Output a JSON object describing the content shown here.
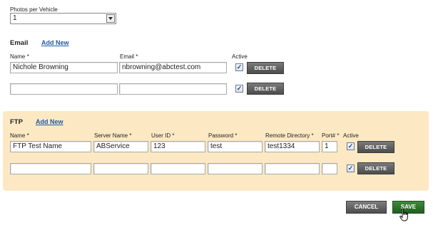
{
  "photos": {
    "label": "Photos per Vehicle",
    "selected": "1"
  },
  "email": {
    "title": "Email",
    "add_new": "Add New",
    "headers": {
      "name": "Name *",
      "email": "Email *",
      "active": "Active"
    },
    "rows": [
      {
        "name": "Nichole Browning",
        "email": "nbrowning@abctest.com",
        "active": true,
        "delete": "DELETE"
      },
      {
        "name": "",
        "email": "",
        "active": true,
        "delete": "DELETE"
      }
    ]
  },
  "ftp": {
    "title": "FTP",
    "add_new": "Add New",
    "headers": {
      "name": "Name *",
      "server": "Server Name *",
      "user": "User ID *",
      "password": "Password *",
      "remote": "Remote Directory *",
      "port": "Port# *",
      "active": "Active"
    },
    "rows": [
      {
        "name": "FTP Test Name",
        "server": "ABService",
        "user": "123",
        "password": "test",
        "remote": "test1334",
        "port": "1",
        "active": true,
        "delete": "DELETE"
      },
      {
        "name": "",
        "server": "",
        "user": "",
        "password": "",
        "remote": "",
        "port": "",
        "active": true,
        "delete": "DELETE"
      }
    ]
  },
  "actions": {
    "cancel": "CANCEL",
    "save": "SAVE"
  },
  "icons": {
    "checkbox": "checkmark-icon",
    "cursor": "hand-pointer-icon",
    "dropdown": "chevron-down-icon"
  }
}
